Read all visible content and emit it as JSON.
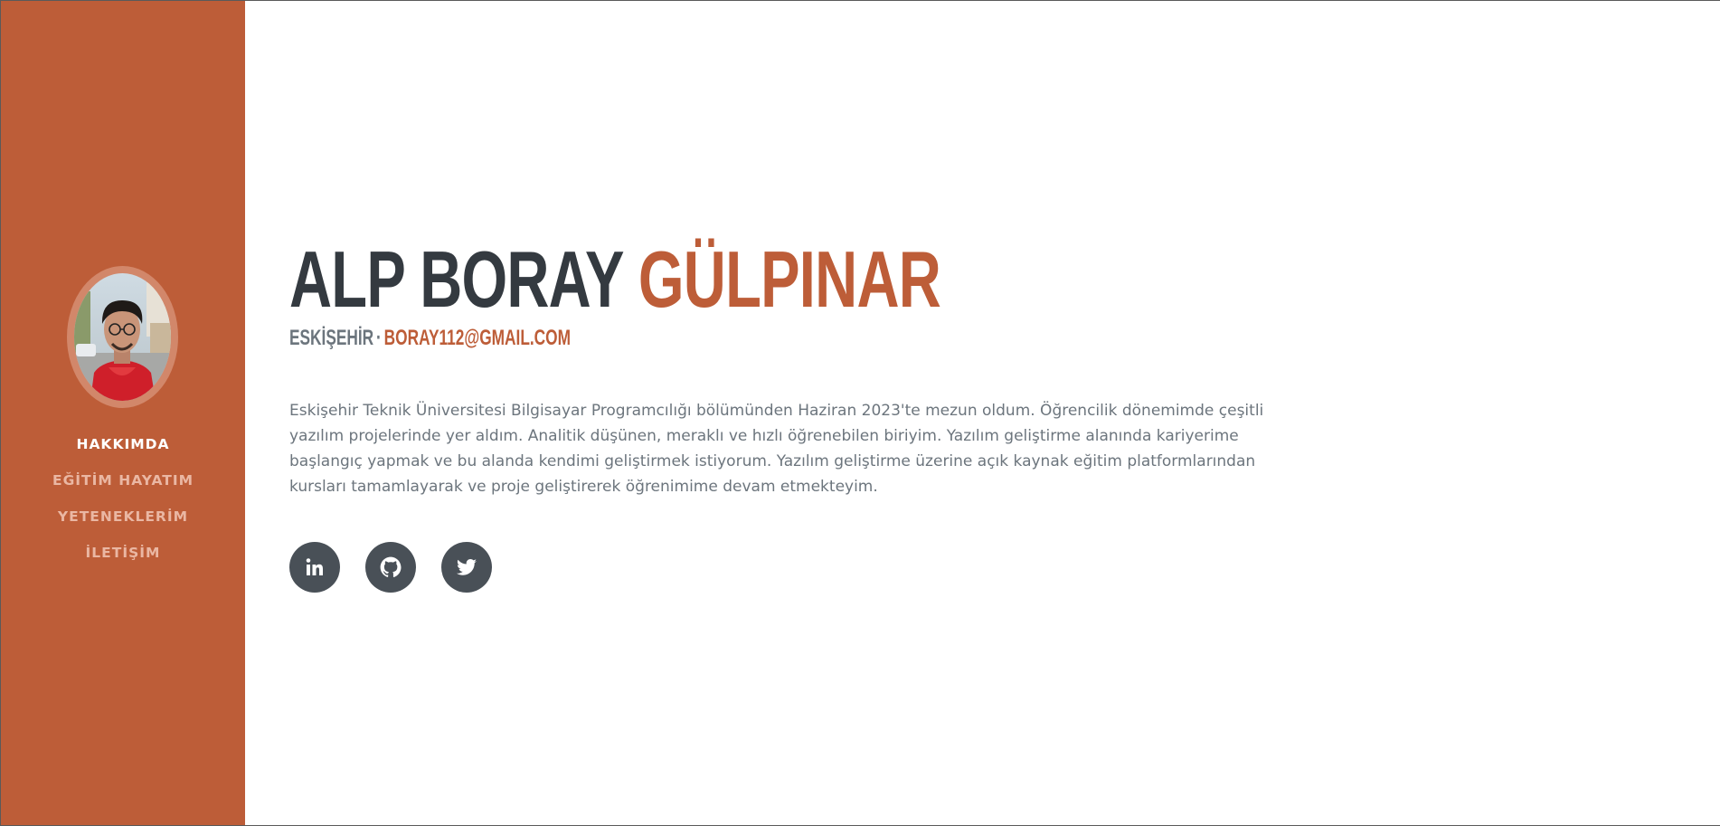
{
  "profile": {
    "first_name": "ALP BORAY",
    "last_name": "GÜLPINAR",
    "city": "ESKİŞEHİR",
    "separator": "·",
    "email": "BORAY112@GMAIL.COM",
    "avatar_icon": "person-photo"
  },
  "nav": {
    "items": [
      {
        "label": "HAKKIMDA",
        "active": true
      },
      {
        "label": "EĞİTİM HAYATIM",
        "active": false
      },
      {
        "label": "YETENEKLERİM",
        "active": false
      },
      {
        "label": "İLETİŞİM",
        "active": false
      }
    ]
  },
  "about": {
    "text": "Eskişehir Teknik Üniversitesi Bilgisayar Programcılığı bölümünden Haziran 2023'te mezun oldum. Öğrencilik dönemimde çeşitli\nyazılım projelerinde yer aldım. Analitik düşünen, meraklı ve hızlı öğrenebilen biriyim. Yazılım geliştirme alanında kariyerime\nbaşlangıç yapmak ve bu alanda kendimi geliştirmek istiyorum. Yazılım geliştirme üzerine açık kaynak eğitim platformlarından\nkursları tamamlayarak ve proje geliştirerek öğrenimime devam etmekteyim."
  },
  "social": {
    "icons": [
      "linkedin-icon",
      "github-icon",
      "twitter-icon"
    ]
  },
  "colors": {
    "accent": "#bd5d38",
    "heading": "#343a40",
    "muted": "#6c757d",
    "social_bg": "#495057"
  }
}
